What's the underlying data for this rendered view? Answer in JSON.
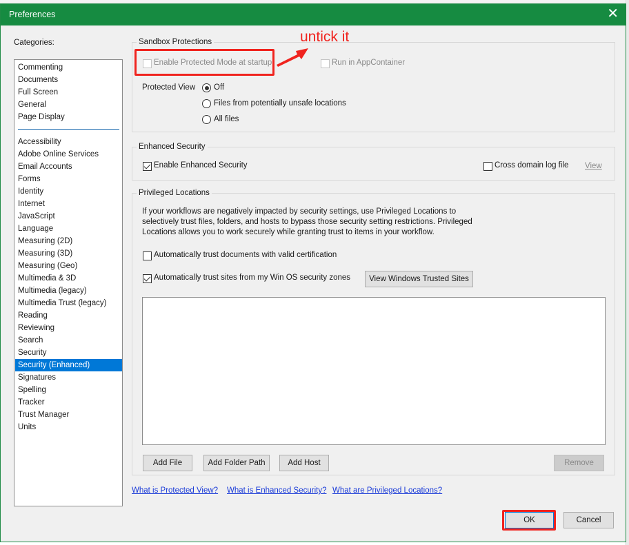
{
  "window": {
    "title": "Preferences",
    "close_icon": "close-x"
  },
  "categories": {
    "label": "Categories:",
    "top_items": [
      "Commenting",
      "Documents",
      "Full Screen",
      "General",
      "Page Display"
    ],
    "items": [
      "Accessibility",
      "Adobe Online Services",
      "Email Accounts",
      "Forms",
      "Identity",
      "Internet",
      "JavaScript",
      "Language",
      "Measuring (2D)",
      "Measuring (3D)",
      "Measuring (Geo)",
      "Multimedia & 3D",
      "Multimedia (legacy)",
      "Multimedia Trust (legacy)",
      "Reading",
      "Reviewing",
      "Search",
      "Security",
      "Security (Enhanced)",
      "Signatures",
      "Spelling",
      "Tracker",
      "Trust Manager",
      "Units"
    ],
    "selected": "Security (Enhanced)"
  },
  "sandbox": {
    "title": "Sandbox Protections",
    "protected_mode_label": "Enable Protected Mode at startup",
    "protected_mode_checked": false,
    "appcontainer_label": "Run in AppContainer",
    "appcontainer_checked": false,
    "protected_view_label": "Protected View",
    "protected_view_options": [
      "Off",
      "Files from potentially unsafe locations",
      "All files"
    ],
    "protected_view_selected": "Off"
  },
  "enhanced": {
    "title": "Enhanced Security",
    "enable_label": "Enable Enhanced Security",
    "enable_checked": true,
    "cross_domain_label": "Cross domain log file",
    "cross_domain_checked": false,
    "view_link": "View"
  },
  "privileged": {
    "title": "Privileged Locations",
    "description_lines": [
      "If your workflows are negatively impacted by security settings, use Privileged Locations to",
      "selectively trust files, folders, and hosts to bypass those security setting restrictions. Privileged",
      "Locations allows you to work securely while granting trust to items in your workflow."
    ],
    "trust_cert_label": "Automatically trust documents with valid certification",
    "trust_cert_checked": false,
    "trust_sites_label": "Automatically trust sites from my Win OS security zones",
    "trust_sites_checked": true,
    "view_trusted_sites_label": "View Windows Trusted Sites",
    "locations": [],
    "add_file_label": "Add File",
    "add_folder_label": "Add Folder Path",
    "add_host_label": "Add Host",
    "remove_label": "Remove"
  },
  "help_links": [
    "What is Protected View?",
    "What is Enhanced Security?",
    "What are Privileged Locations?"
  ],
  "footer": {
    "ok_label": "OK",
    "cancel_label": "Cancel"
  },
  "annotation": {
    "text": "untick it",
    "color": "#f0231e"
  }
}
